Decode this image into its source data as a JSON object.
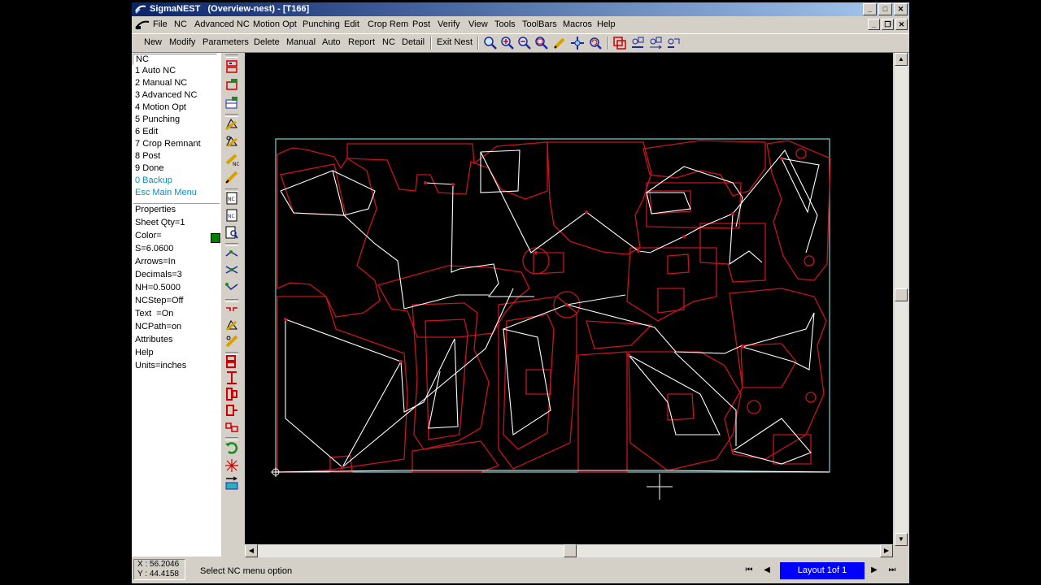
{
  "window": {
    "title": "SigmaNEST   (Overview-nest) - [T166]",
    "controls": {
      "minimize": "_",
      "maximize": "□",
      "close": "✕"
    },
    "mdi_controls": {
      "minimize": "_",
      "restore": "❐",
      "close": "✕"
    }
  },
  "menubar": [
    "File",
    "NC",
    "Advanced NC",
    "Motion Opt",
    "Punching",
    "Edit",
    "Crop Rem",
    "Post",
    "Verify",
    "View",
    "Tools",
    "ToolBars",
    "Macros",
    "Help"
  ],
  "toolbar": {
    "buttons": [
      "New",
      "Modify",
      "Parameters",
      "Delete",
      "Manual",
      "Auto",
      "Report",
      "NC",
      "Detail"
    ],
    "exit_nest": "Exit Nest",
    "icons": [
      "zoom-icon",
      "zoom-in-icon",
      "zoom-out-icon",
      "zoom-window-icon",
      "pencil-icon",
      "pan-icon",
      "refresh-icon",
      "select-icon",
      "align-icon",
      "mirror-icon",
      "copy-icon"
    ]
  },
  "left_panel": {
    "nc_header": "NC",
    "nc_menu": [
      {
        "key": "1",
        "label": "Auto NC"
      },
      {
        "key": "2",
        "label": "Manual NC"
      },
      {
        "key": "3",
        "label": "Advanced NC"
      },
      {
        "key": "4",
        "label": "Motion Opt"
      },
      {
        "key": "5",
        "label": "Punching"
      },
      {
        "key": "6",
        "label": "Edit"
      },
      {
        "key": "7",
        "label": "Crop Remnant"
      },
      {
        "key": "8",
        "label": "Post"
      },
      {
        "key": "9",
        "label": "Done"
      }
    ],
    "backup": "0 Backup",
    "main_menu": "Esc Main Menu",
    "properties_header": "Properties",
    "properties": [
      "Sheet Qty=1",
      "Color=",
      "S=6.0600",
      "Arrows=In",
      "Decimals=3",
      "NH=0.5000",
      "NCStep=Off",
      "Text  =On",
      "NCPath=on",
      "Attributes",
      "Help",
      "Units=inches"
    ],
    "color_value": "#008000"
  },
  "status": {
    "x": "X : 56.2046",
    "y": "Y : 44.4158",
    "message": "Select NC menu option",
    "layout": "Layout 1of 1",
    "nav": {
      "first": "⏮",
      "prev": "◀",
      "next": "▶",
      "last": "⏭"
    }
  },
  "colors": {
    "title_start": "#0a246a",
    "title_end": "#a6caf0",
    "part_outline": "#c8141e",
    "nc_path": "#ffffff",
    "sheet": "#7fd0d0",
    "layout_box": "#0000ff",
    "backup_link": "#0d8fb8"
  }
}
